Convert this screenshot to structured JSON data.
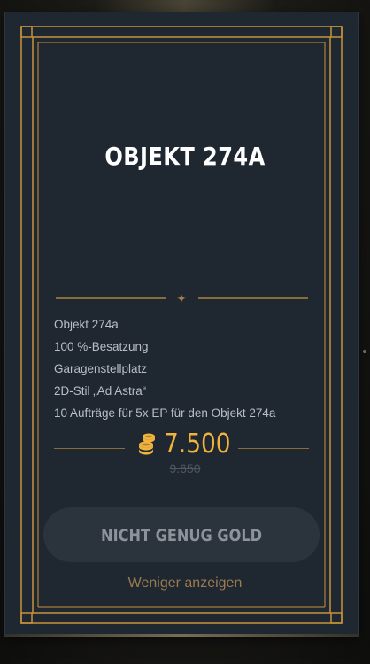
{
  "offer": {
    "title": "OBJEKT 274A",
    "features": [
      "Objekt 274a",
      "100 %-Besatzung",
      "Garagenstellplatz",
      "2D-Stil „Ad Astra“",
      "10 Aufträge für 5x EP für den Objekt 274a"
    ],
    "price": "7.500",
    "old_price": "9.650",
    "currency_icon": "gold-coins-icon",
    "button_label": "NICHT GENUG GOLD",
    "show_less_label": "Weniger anzeigen"
  },
  "colors": {
    "card_bg": "#1f2731",
    "gold_frame": "#c8933a",
    "price": "#f2b33d",
    "button_bg": "#2b333d",
    "button_text": "#8c939b",
    "link": "#9a7b4f"
  }
}
